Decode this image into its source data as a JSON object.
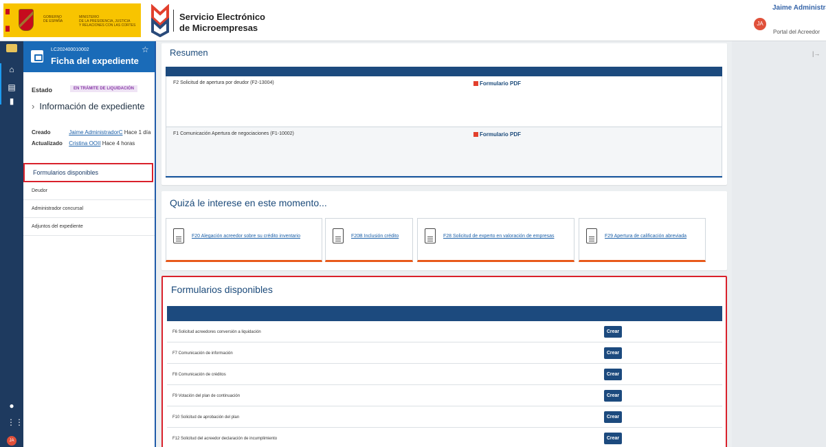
{
  "header": {
    "gov_line1": "GOBIERNO",
    "gov_line2": "DE ESPAÑA",
    "ministry_line1": "MINISTERIO",
    "ministry_line2": "DE LA PRESIDENCIA, JUSTICIA",
    "ministry_line3": "Y RELACIONES CON LAS CORTES",
    "brand_line1": "Servicio Electrónico",
    "brand_line2": "de Microempresas",
    "user_initials": "JA",
    "user_name": "Jaime Administrado",
    "user_portal": "Portal del Acreedor"
  },
  "file_card": {
    "code": "LC202400010002",
    "title": "Ficha del expediente"
  },
  "sidebar": {
    "estado_label": "Estado",
    "estado_value": "EN TRÁMITE DE LIQUIDACIÓN",
    "info_heading": "Información de expediente",
    "created_label": "Creado",
    "created_user": "Jaime AdministradorC",
    "created_time": "Hace 1 día",
    "updated_label": "Actualizado",
    "updated_user": "Cristina OOII",
    "updated_time": "Hace 4 horas",
    "nav": [
      {
        "label": "Formularios disponibles"
      },
      {
        "label": "Deudor"
      },
      {
        "label": "Administrador concursal"
      },
      {
        "label": "Adjuntos del expediente"
      }
    ]
  },
  "resumen": {
    "title": "Resumen",
    "rows": [
      {
        "name": "F2 Solicitud de apertura por deudor (F2-13004)",
        "pdf_label": "Formulario PDF"
      },
      {
        "name": "F1 Comunicación Apertura de negociaciones (F1-10002)",
        "pdf_label": "Formulario PDF"
      }
    ]
  },
  "suggest": {
    "title": "Quizá le interese en este momento...",
    "tiles": [
      {
        "label": "F20 Alegación acreedor sobre su crédito inventario"
      },
      {
        "label": "F20B Inclusión crédito"
      },
      {
        "label": "F28 Solicitud de experto en valoración de empresas"
      },
      {
        "label": "F29 Apertura de calificación abreviada"
      }
    ]
  },
  "forms": {
    "title": "Formularios disponibles",
    "button_label": "Crear",
    "rows": [
      {
        "name": "F6 Solicitud acreedores conversión a liquidación"
      },
      {
        "name": "F7 Comunicación de información"
      },
      {
        "name": "F8 Comunicación de créditos"
      },
      {
        "name": "F9 Votación del plan de continuación"
      },
      {
        "name": "F10 Solicitud de aprobación del plan"
      },
      {
        "name": "F12 Solicitud del acreedor declaración de incumplimiento"
      }
    ]
  },
  "colors": {
    "primary_dark": "#1c4a7e",
    "highlight_red": "#d9202a",
    "accent_orange": "#e8591a"
  }
}
